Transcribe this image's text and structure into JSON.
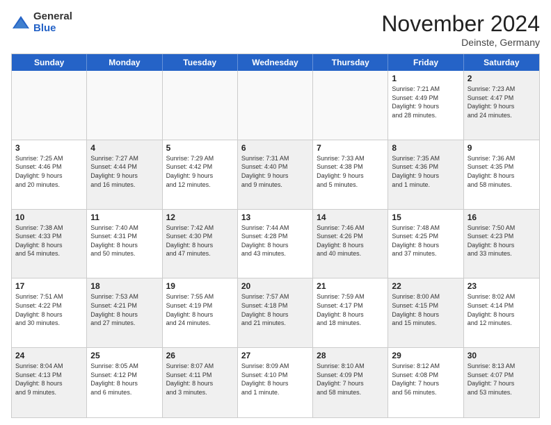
{
  "logo": {
    "general": "General",
    "blue": "Blue"
  },
  "title": "November 2024",
  "location": "Deinste, Germany",
  "header_days": [
    "Sunday",
    "Monday",
    "Tuesday",
    "Wednesday",
    "Thursday",
    "Friday",
    "Saturday"
  ],
  "weeks": [
    [
      {
        "day": "",
        "info": "",
        "empty": true
      },
      {
        "day": "",
        "info": "",
        "empty": true
      },
      {
        "day": "",
        "info": "",
        "empty": true
      },
      {
        "day": "",
        "info": "",
        "empty": true
      },
      {
        "day": "",
        "info": "",
        "empty": true
      },
      {
        "day": "1",
        "info": "Sunrise: 7:21 AM\nSunset: 4:49 PM\nDaylight: 9 hours\nand 28 minutes."
      },
      {
        "day": "2",
        "info": "Sunrise: 7:23 AM\nSunset: 4:47 PM\nDaylight: 9 hours\nand 24 minutes.",
        "shaded": true
      }
    ],
    [
      {
        "day": "3",
        "info": "Sunrise: 7:25 AM\nSunset: 4:46 PM\nDaylight: 9 hours\nand 20 minutes."
      },
      {
        "day": "4",
        "info": "Sunrise: 7:27 AM\nSunset: 4:44 PM\nDaylight: 9 hours\nand 16 minutes.",
        "shaded": true
      },
      {
        "day": "5",
        "info": "Sunrise: 7:29 AM\nSunset: 4:42 PM\nDaylight: 9 hours\nand 12 minutes."
      },
      {
        "day": "6",
        "info": "Sunrise: 7:31 AM\nSunset: 4:40 PM\nDaylight: 9 hours\nand 9 minutes.",
        "shaded": true
      },
      {
        "day": "7",
        "info": "Sunrise: 7:33 AM\nSunset: 4:38 PM\nDaylight: 9 hours\nand 5 minutes."
      },
      {
        "day": "8",
        "info": "Sunrise: 7:35 AM\nSunset: 4:36 PM\nDaylight: 9 hours\nand 1 minute.",
        "shaded": true
      },
      {
        "day": "9",
        "info": "Sunrise: 7:36 AM\nSunset: 4:35 PM\nDaylight: 8 hours\nand 58 minutes."
      }
    ],
    [
      {
        "day": "10",
        "info": "Sunrise: 7:38 AM\nSunset: 4:33 PM\nDaylight: 8 hours\nand 54 minutes.",
        "shaded": true
      },
      {
        "day": "11",
        "info": "Sunrise: 7:40 AM\nSunset: 4:31 PM\nDaylight: 8 hours\nand 50 minutes."
      },
      {
        "day": "12",
        "info": "Sunrise: 7:42 AM\nSunset: 4:30 PM\nDaylight: 8 hours\nand 47 minutes.",
        "shaded": true
      },
      {
        "day": "13",
        "info": "Sunrise: 7:44 AM\nSunset: 4:28 PM\nDaylight: 8 hours\nand 43 minutes."
      },
      {
        "day": "14",
        "info": "Sunrise: 7:46 AM\nSunset: 4:26 PM\nDaylight: 8 hours\nand 40 minutes.",
        "shaded": true
      },
      {
        "day": "15",
        "info": "Sunrise: 7:48 AM\nSunset: 4:25 PM\nDaylight: 8 hours\nand 37 minutes."
      },
      {
        "day": "16",
        "info": "Sunrise: 7:50 AM\nSunset: 4:23 PM\nDaylight: 8 hours\nand 33 minutes.",
        "shaded": true
      }
    ],
    [
      {
        "day": "17",
        "info": "Sunrise: 7:51 AM\nSunset: 4:22 PM\nDaylight: 8 hours\nand 30 minutes."
      },
      {
        "day": "18",
        "info": "Sunrise: 7:53 AM\nSunset: 4:21 PM\nDaylight: 8 hours\nand 27 minutes.",
        "shaded": true
      },
      {
        "day": "19",
        "info": "Sunrise: 7:55 AM\nSunset: 4:19 PM\nDaylight: 8 hours\nand 24 minutes."
      },
      {
        "day": "20",
        "info": "Sunrise: 7:57 AM\nSunset: 4:18 PM\nDaylight: 8 hours\nand 21 minutes.",
        "shaded": true
      },
      {
        "day": "21",
        "info": "Sunrise: 7:59 AM\nSunset: 4:17 PM\nDaylight: 8 hours\nand 18 minutes."
      },
      {
        "day": "22",
        "info": "Sunrise: 8:00 AM\nSunset: 4:15 PM\nDaylight: 8 hours\nand 15 minutes.",
        "shaded": true
      },
      {
        "day": "23",
        "info": "Sunrise: 8:02 AM\nSunset: 4:14 PM\nDaylight: 8 hours\nand 12 minutes."
      }
    ],
    [
      {
        "day": "24",
        "info": "Sunrise: 8:04 AM\nSunset: 4:13 PM\nDaylight: 8 hours\nand 9 minutes.",
        "shaded": true
      },
      {
        "day": "25",
        "info": "Sunrise: 8:05 AM\nSunset: 4:12 PM\nDaylight: 8 hours\nand 6 minutes."
      },
      {
        "day": "26",
        "info": "Sunrise: 8:07 AM\nSunset: 4:11 PM\nDaylight: 8 hours\nand 3 minutes.",
        "shaded": true
      },
      {
        "day": "27",
        "info": "Sunrise: 8:09 AM\nSunset: 4:10 PM\nDaylight: 8 hours\nand 1 minute."
      },
      {
        "day": "28",
        "info": "Sunrise: 8:10 AM\nSunset: 4:09 PM\nDaylight: 7 hours\nand 58 minutes.",
        "shaded": true
      },
      {
        "day": "29",
        "info": "Sunrise: 8:12 AM\nSunset: 4:08 PM\nDaylight: 7 hours\nand 56 minutes."
      },
      {
        "day": "30",
        "info": "Sunrise: 8:13 AM\nSunset: 4:07 PM\nDaylight: 7 hours\nand 53 minutes.",
        "shaded": true
      }
    ]
  ]
}
